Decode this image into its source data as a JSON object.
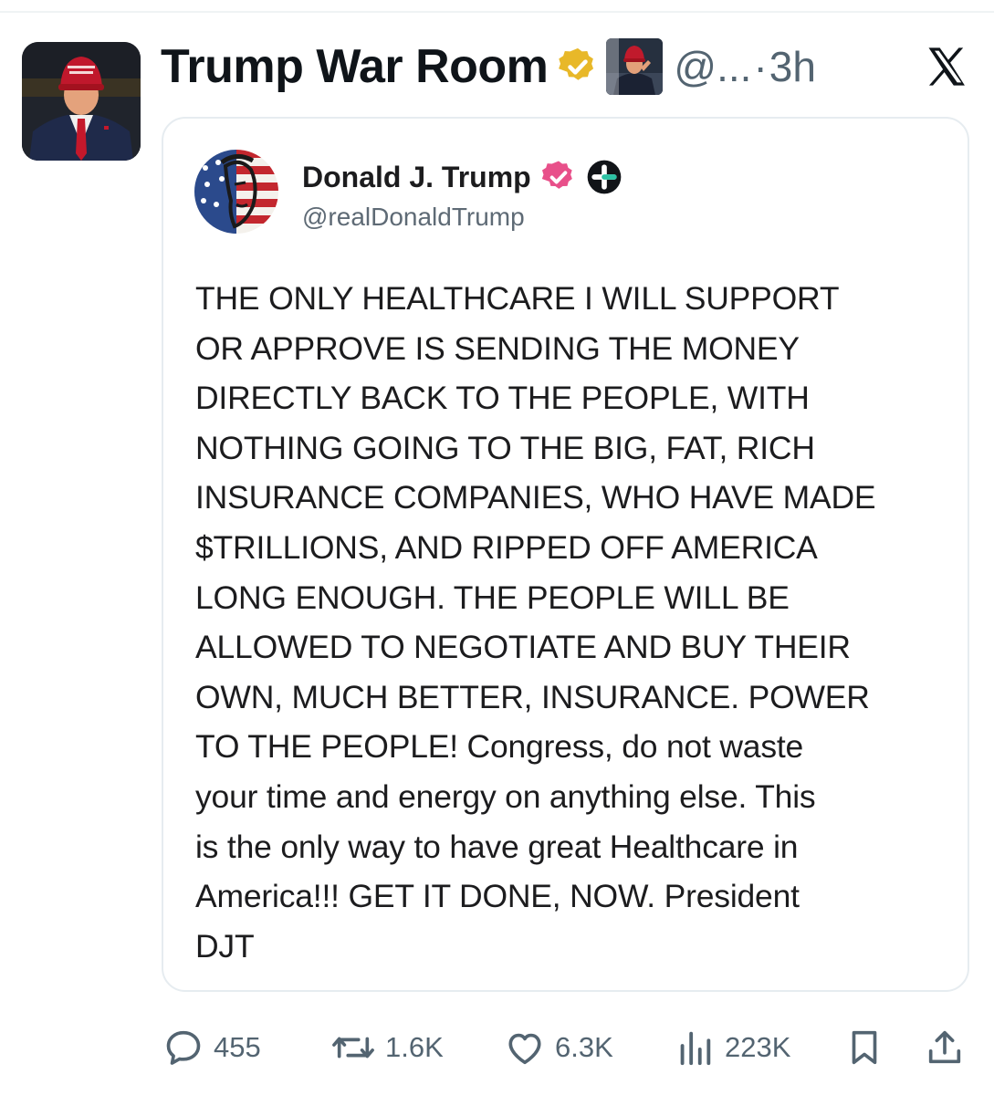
{
  "post": {
    "author_name": "Trump War Room",
    "handle": "@...",
    "separator": "·",
    "time": "3h"
  },
  "quote": {
    "author_name": "Donald J. Trump",
    "handle": "@realDonaldTrump",
    "body_lines": [
      "THE ONLY HEALTHCARE I WILL SUPPORT",
      "OR APPROVE IS SENDING THE MONEY",
      "DIRECTLY BACK TO THE PEOPLE, WITH",
      "NOTHING GOING TO THE BIG, FAT, RICH",
      "INSURANCE COMPANIES, WHO HAVE MADE",
      "$TRILLIONS, AND RIPPED OFF AMERICA",
      "LONG ENOUGH. THE PEOPLE WILL BE",
      "ALLOWED TO NEGOTIATE AND BUY THEIR",
      "OWN, MUCH BETTER, INSURANCE. POWER",
      "TO THE PEOPLE! Congress, do not waste",
      "your time and energy on anything else. This",
      "is the only way to have great Healthcare in",
      "America!!! GET IT DONE, NOW. President",
      "DJT"
    ]
  },
  "actions": {
    "replies": "455",
    "reposts": "1.6K",
    "likes": "6.3K",
    "views": "223K"
  },
  "colors": {
    "verified_gold": "#e8b829",
    "verified_pink": "#e8508a",
    "secondary_text": "#536471",
    "border": "#e6ecf0"
  },
  "icons": [
    "gold-verified-badge-icon",
    "x-logo-icon",
    "pink-verified-badge-icon",
    "plus-badge-icon",
    "reply-icon",
    "repost-icon",
    "like-icon",
    "views-icon",
    "bookmark-icon",
    "share-icon"
  ]
}
